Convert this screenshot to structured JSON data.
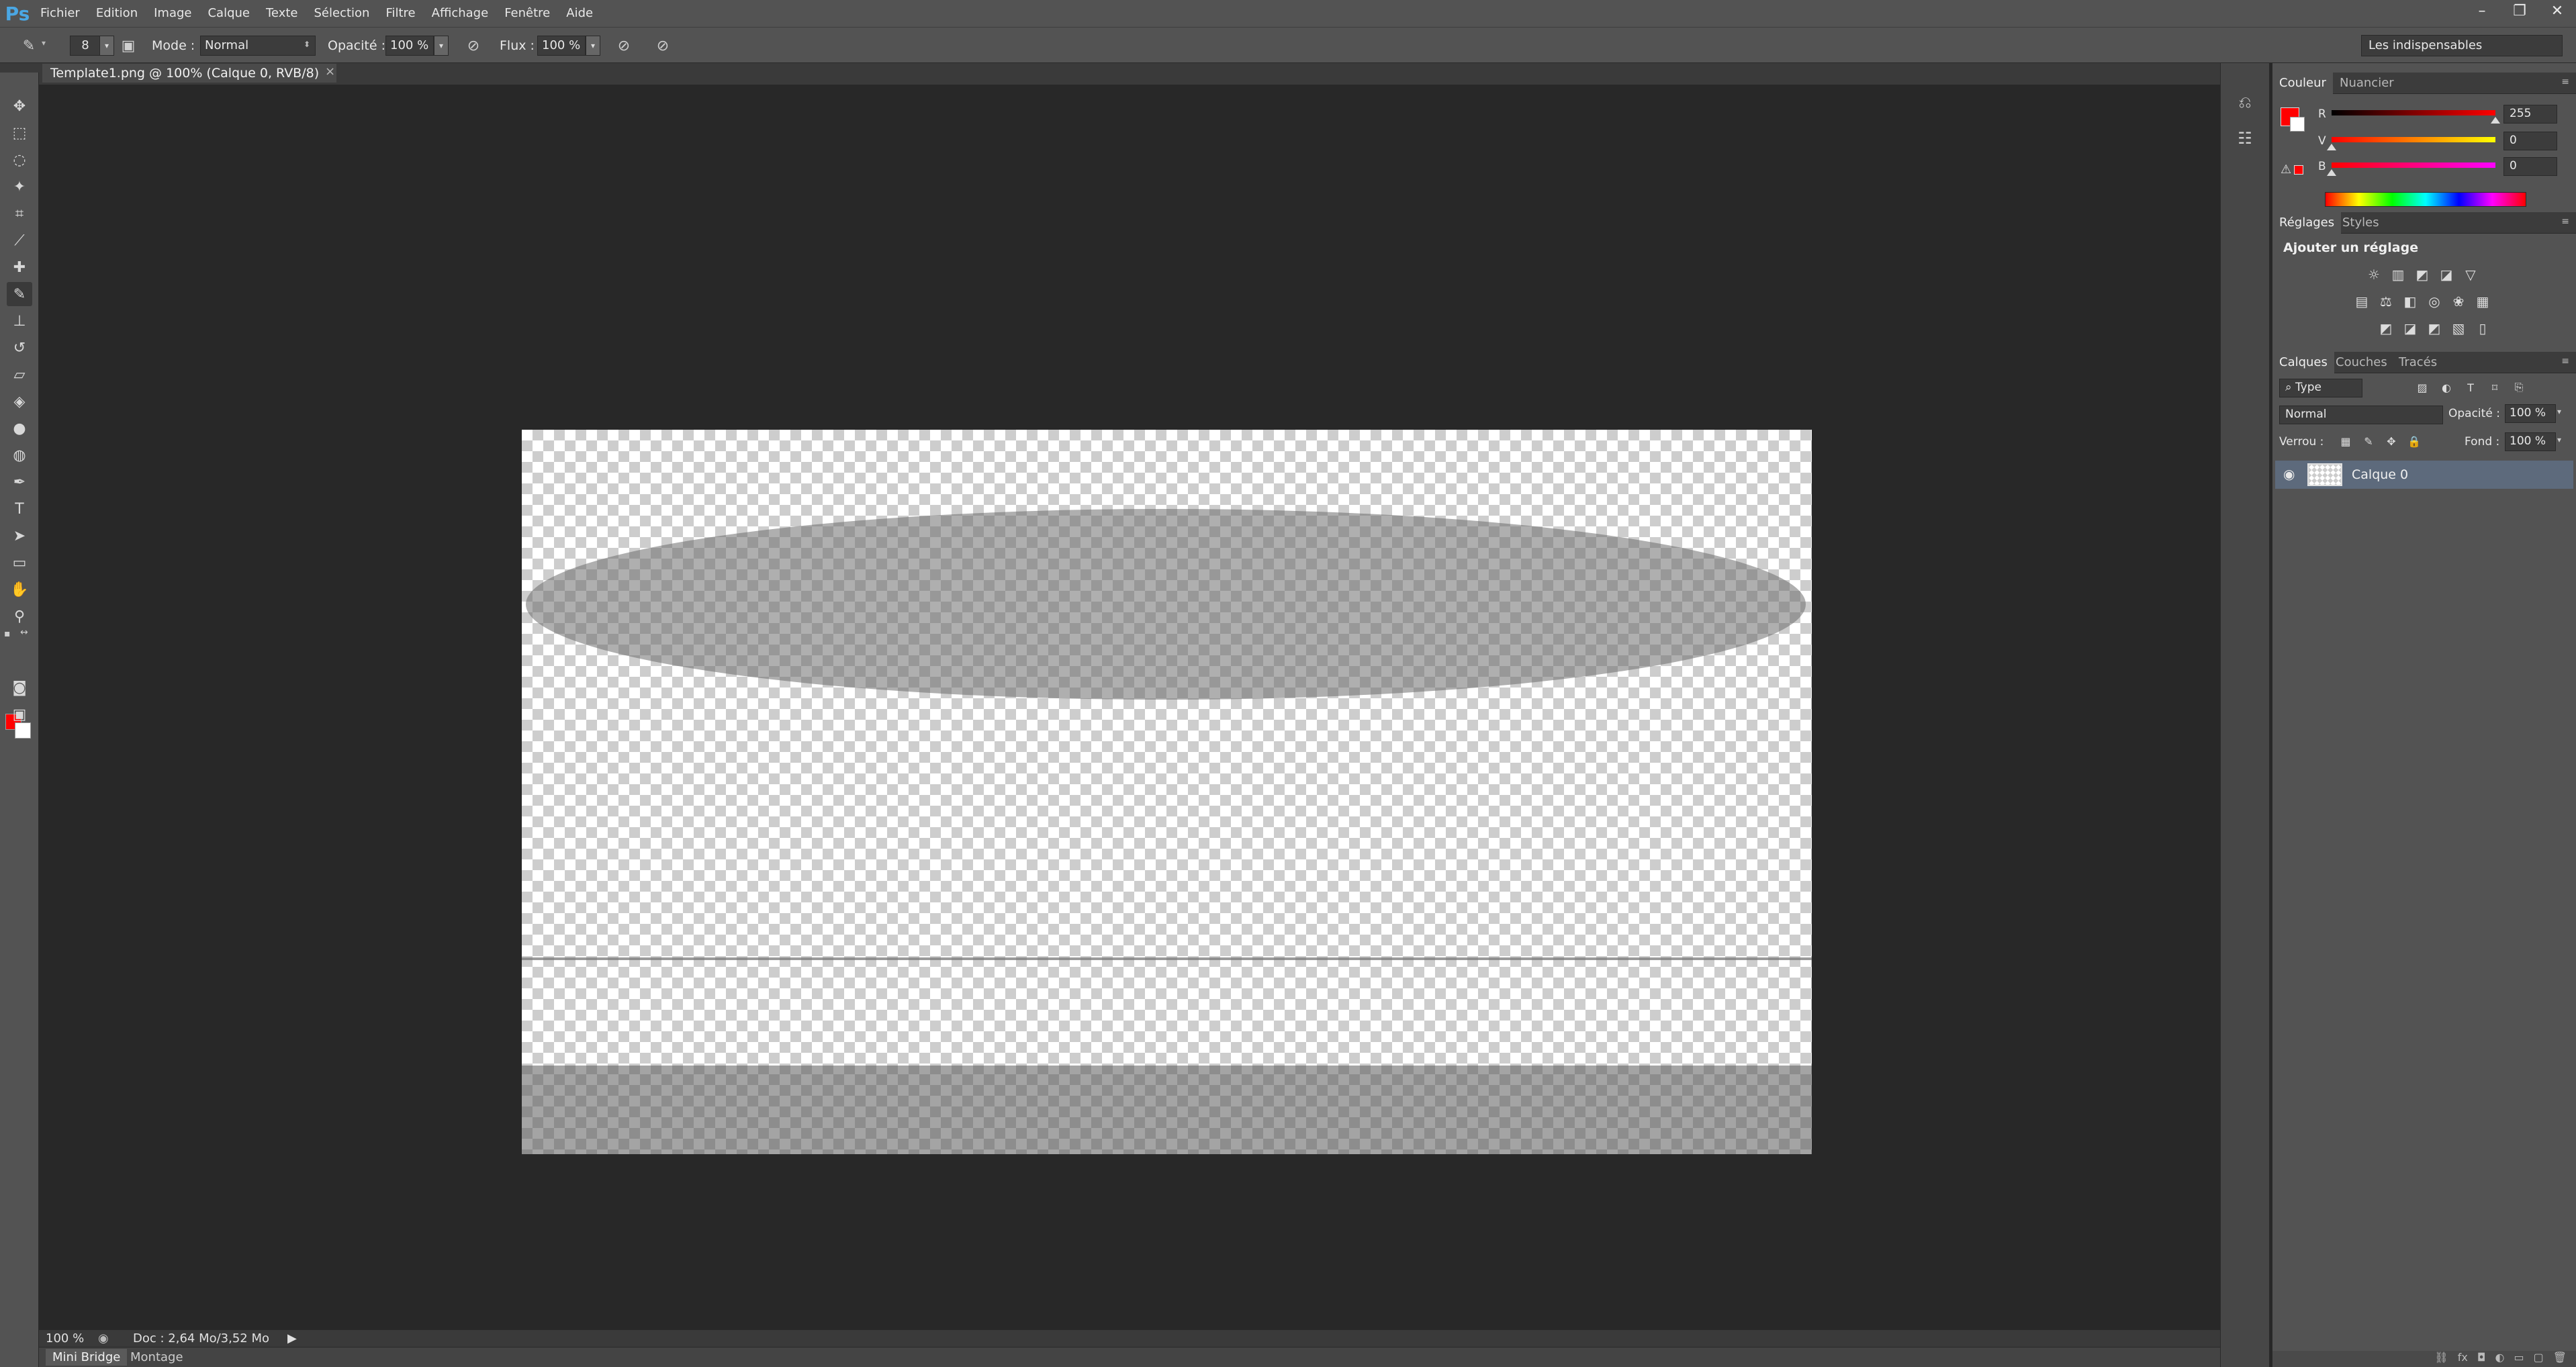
{
  "app": {
    "logo": "Ps"
  },
  "menu": [
    "Fichier",
    "Edition",
    "Image",
    "Calque",
    "Texte",
    "Sélection",
    "Filtre",
    "Affichage",
    "Fenêtre",
    "Aide"
  ],
  "window_controls": {
    "minimize": "–",
    "restore": "❐",
    "close": "✕"
  },
  "options_bar": {
    "brush_size": "8",
    "mode_label": "Mode :",
    "mode_value": "Normal",
    "opacity_label": "Opacité :",
    "opacity_value": "100 %",
    "flow_label": "Flux :",
    "flow_value": "100 %",
    "workspace": "Les indispensables"
  },
  "document": {
    "tab_title": "Template1.png @ 100% (Calque 0, RVB/8)",
    "tab_close": "×"
  },
  "status": {
    "zoom": "100 %",
    "doc_info": "Doc : 2,64 Mo/3,52 Mo",
    "arrow": "▶"
  },
  "bottom_tabs": [
    "Mini Bridge",
    "Montage"
  ],
  "color_panel": {
    "tabs": [
      "Couleur",
      "Nuancier"
    ],
    "channels": [
      {
        "label": "R",
        "value": "255",
        "gradient_from": "#000000",
        "gradient_to": "#ff0000",
        "level": 1.0
      },
      {
        "label": "V",
        "value": "0",
        "gradient_from": "#ff0000",
        "gradient_to": "#ffff00",
        "level": 0.0
      },
      {
        "label": "B",
        "value": "0",
        "gradient_from": "#ff0000",
        "gradient_to": "#ff00ff",
        "level": 0.0
      }
    ],
    "foreground": "#ff0000",
    "background": "#ffffff"
  },
  "adjustments_panel": {
    "tabs": [
      "Réglages",
      "Styles"
    ],
    "heading": "Ajouter un réglage"
  },
  "layers_panel": {
    "tabs": [
      "Calques",
      "Couches",
      "Tracés"
    ],
    "filter_value": "Type",
    "blend_mode": "Normal",
    "opacity_label": "Opacité :",
    "opacity_value": "100 %",
    "lock_label": "Verrou :",
    "fill_label": "Fond :",
    "fill_value": "100 %",
    "layers": [
      {
        "name": "Calque 0",
        "visible": true,
        "selected": true
      }
    ]
  },
  "colors": {
    "app_bg": "#282828",
    "panel_bg": "#535353",
    "accent_fg": "#ff0000",
    "selected_layer": "#5d6a7c"
  }
}
